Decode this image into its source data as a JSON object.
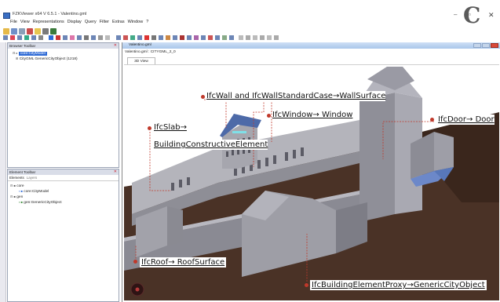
{
  "app": {
    "title": "FZKViewer x64 V 6.5.1 - Valentino.gml",
    "menu": [
      "File",
      "View",
      "Representations",
      "Display",
      "Query",
      "Filter",
      "Extras",
      "Window",
      "?"
    ]
  },
  "explorer": {
    "title": "Browser Toolbar",
    "items": [
      {
        "label": "core:CityModel",
        "selected": true
      },
      {
        "label": "CityGML GenericCityObject (1218)",
        "selected": false
      }
    ]
  },
  "element_toolbar": {
    "title": "Element Toolbar",
    "tabs": [
      "Elements",
      "Layers"
    ],
    "tree": [
      {
        "label": "core",
        "level": 0
      },
      {
        "label": "core:CityModel",
        "level": 1
      },
      {
        "label": "gen",
        "level": 0
      },
      {
        "label": "gen:GenericCityObject",
        "level": 1
      }
    ]
  },
  "document": {
    "window_title": "Valentino.gml",
    "breadcrumb": "Valentino.gml : CITYGML_2_0",
    "tab_label": "3D View"
  },
  "annotations": [
    {
      "id": "wall",
      "text": "IfcWall and IfcWallStandardCase→WallSurface"
    },
    {
      "id": "slab",
      "text": "IfcSlab→"
    },
    {
      "id": "slab2",
      "text": "BuildingConstructiveElement"
    },
    {
      "id": "window",
      "text": "IfcWindow→ Window"
    },
    {
      "id": "door",
      "text": "IfcDoor→ Door"
    },
    {
      "id": "roof",
      "text": "IfcRoof→ RoofSurface"
    },
    {
      "id": "proxy",
      "text": "IfcBuildingElementProxy→GenericCityObject"
    }
  ],
  "colors": {
    "accent": "#2f6bd6",
    "annotation_dot": "#c0392b",
    "leader_line": "#c0392b",
    "ground": "#4a3226",
    "building": "#9b9ba3",
    "roof": "#5b7bbf"
  },
  "icons": [
    "app-icon",
    "close-icon",
    "minimize-icon",
    "maximize-icon"
  ]
}
